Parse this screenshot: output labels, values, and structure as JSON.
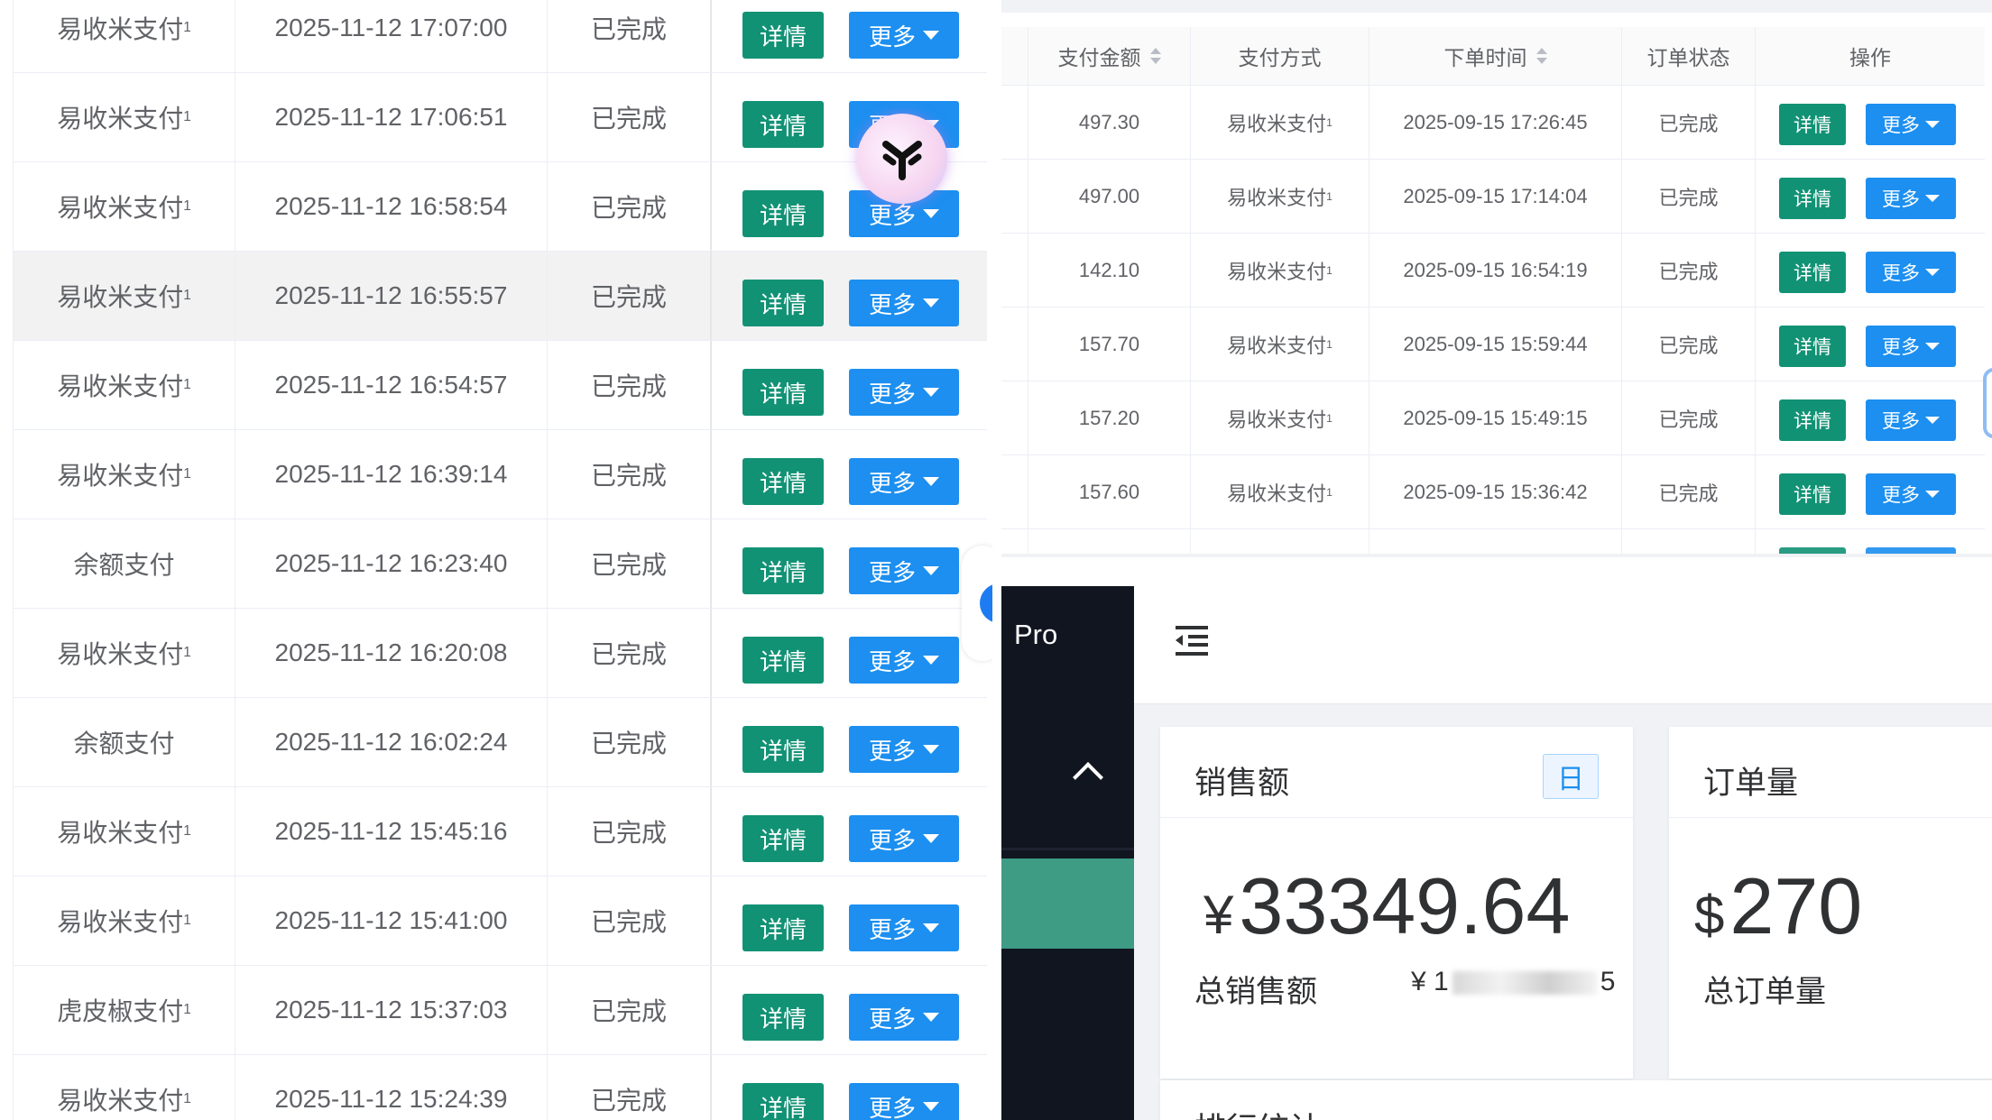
{
  "left_table": {
    "detail_label": "详情",
    "more_label": "更多",
    "rows": [
      {
        "method": "易收米支付",
        "sup": "1",
        "time": "2025-11-12 17:07:00",
        "status": "已完成"
      },
      {
        "method": "易收米支付",
        "sup": "1",
        "time": "2025-11-12 17:06:51",
        "status": "已完成"
      },
      {
        "method": "易收米支付",
        "sup": "1",
        "time": "2025-11-12 16:58:54",
        "status": "已完成"
      },
      {
        "method": "易收米支付",
        "sup": "1",
        "time": "2025-11-12 16:55:57",
        "status": "已完成"
      },
      {
        "method": "易收米支付",
        "sup": "1",
        "time": "2025-11-12 16:54:57",
        "status": "已完成"
      },
      {
        "method": "易收米支付",
        "sup": "1",
        "time": "2025-11-12 16:39:14",
        "status": "已完成"
      },
      {
        "method": "余额支付",
        "sup": "",
        "time": "2025-11-12 16:23:40",
        "status": "已完成"
      },
      {
        "method": "易收米支付",
        "sup": "1",
        "time": "2025-11-12 16:20:08",
        "status": "已完成"
      },
      {
        "method": "余额支付",
        "sup": "",
        "time": "2025-11-12 16:02:24",
        "status": "已完成"
      },
      {
        "method": "易收米支付",
        "sup": "1",
        "time": "2025-11-12 15:45:16",
        "status": "已完成"
      },
      {
        "method": "易收米支付",
        "sup": "1",
        "time": "2025-11-12 15:41:00",
        "status": "已完成"
      },
      {
        "method": "虎皮椒支付",
        "sup": "1",
        "time": "2025-11-12 15:37:03",
        "status": "已完成"
      },
      {
        "method": "易收米支付",
        "sup": "1",
        "time": "2025-11-12 15:24:39",
        "status": "已完成"
      }
    ]
  },
  "right_table": {
    "headers": {
      "amount": "支付金额",
      "method": "支付方式",
      "time": "下单时间",
      "status": "订单状态",
      "action": "操作"
    },
    "detail_label": "详情",
    "more_label": "更多",
    "rows": [
      {
        "amount": "497.30",
        "method": "易收米支付",
        "sup": "1",
        "time": "2025-09-15 17:26:45",
        "status": "已完成"
      },
      {
        "amount": "497.00",
        "method": "易收米支付",
        "sup": "1",
        "time": "2025-09-15 17:14:04",
        "status": "已完成"
      },
      {
        "amount": "142.10",
        "method": "易收米支付",
        "sup": "1",
        "time": "2025-09-15 16:54:19",
        "status": "已完成"
      },
      {
        "amount": "157.70",
        "method": "易收米支付",
        "sup": "1",
        "time": "2025-09-15 15:59:44",
        "status": "已完成"
      },
      {
        "amount": "157.20",
        "method": "易收米支付",
        "sup": "1",
        "time": "2025-09-15 15:49:15",
        "status": "已完成"
      },
      {
        "amount": "157.60",
        "method": "易收米支付",
        "sup": "1",
        "time": "2025-09-15 15:36:42",
        "status": "已完成"
      }
    ]
  },
  "dashboard": {
    "brand": "Pro",
    "sales": {
      "title": "销售额",
      "period_badge": "日",
      "currency": "¥",
      "value": "33349.64",
      "total_label": "总销售额",
      "total_prefix": "¥ 1",
      "total_suffix": "5"
    },
    "orders": {
      "title": "订单量",
      "currency": "$",
      "value": "270",
      "total_label": "总订单量"
    },
    "ranking_title": "排行统计"
  },
  "colors": {
    "detail_green": "#129275",
    "more_blue": "#1c8ff0",
    "sidebar_dark": "#111520",
    "sidebar_active": "#3e9b84"
  },
  "icons": {
    "sort": "sort-caret-icon",
    "dropdown": "caret-down-icon",
    "collapse": "chevron-up-icon",
    "menu": "menu-fold-icon",
    "logo": "brand-logo-icon"
  }
}
